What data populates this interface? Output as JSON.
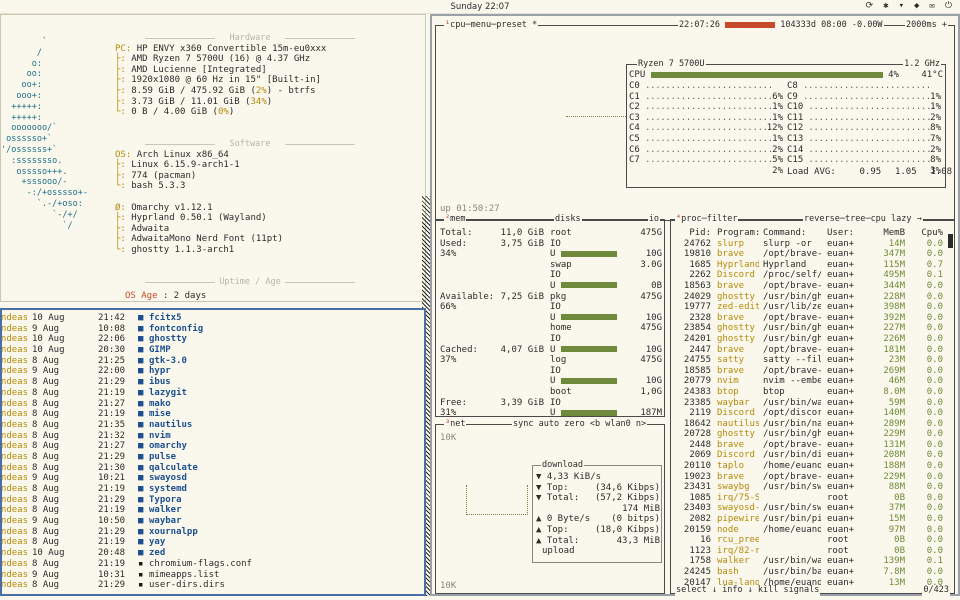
{
  "topbar": {
    "clock": "Sunday 22:07",
    "tray": [
      "⟳",
      "✱",
      "▾",
      "◆",
      "✉",
      "⏻"
    ]
  },
  "fastfetch": {
    "logo": "        `\n       /\n      o:\n     oo:\n    oo+:\n   ooo+:\n  +++++:\n  +++++:\n  ooooooo/`\n ossssso+`\n'/ossssss+`\n  :ssssssso.\n   osssso+++.\n    +sssooo/-\n     -:/+osssso+-\n       `.-/+oso:\n          `-/+/\n            `/",
    "hardware_title": "Hardware",
    "hardware": [
      {
        "k": "PC:",
        "v": "HP ENVY x360 Convertible 15m-eu0xxx"
      },
      {
        "k": "├:",
        "v": "AMD Ryzen 7 5700U (16) @ 4.37 GHz"
      },
      {
        "k": "├:",
        "v": "AMD Lucienne [Integrated]"
      },
      {
        "k": "├:",
        "v": "1920x1080 @ 60 Hz in 15\" [Built-in]"
      },
      {
        "k": "├:",
        "v": "8.59 GiB / 475.92 GiB (",
        "p": "2%",
        "s": ") - btrfs"
      },
      {
        "k": "├:",
        "v": "3.73 GiB / 11.01 GiB (",
        "p": "34%",
        "s": ")"
      },
      {
        "k": "└:",
        "v": "0 B / 4.00 GiB (",
        "p": "0%",
        "s": ")"
      }
    ],
    "software_title": "Software",
    "software": [
      {
        "k": "OS:",
        "v": "Arch Linux x86_64"
      },
      {
        "k": "├:",
        "v": "Linux 6.15.9-arch1-1"
      },
      {
        "k": "├:",
        "v": "774 (pacman)"
      },
      {
        "k": "└:",
        "v": "bash 5.3.3"
      },
      {
        "k": "",
        "v": ""
      },
      {
        "k": "Ø:",
        "v": "Omarchy v1.12.1"
      },
      {
        "k": "├:",
        "v": "Hyprland 0.50.1 (Wayland)"
      },
      {
        "k": "├:",
        "v": "Adwaita"
      },
      {
        "k": "├:",
        "v": "AdwaitaMono Nerd Font (11pt)"
      },
      {
        "k": "└:",
        "v": "ghostty 1.1.3-arch1"
      }
    ],
    "uptime_title": "Uptime / Age",
    "uptime_k": "OS Age",
    "uptime_v": ": 2 days"
  },
  "files": [
    {
      "u": "ndeas",
      "d": "10 Aug",
      "t": "21:42",
      "n": "fcitx5",
      "dir": true
    },
    {
      "u": "ndeas",
      "d": " 9 Aug",
      "t": "10:08",
      "n": "fontconfig",
      "dir": true
    },
    {
      "u": "ndeas",
      "d": "10 Aug",
      "t": "22:06",
      "n": "ghostty",
      "dir": true
    },
    {
      "u": "ndeas",
      "d": "10 Aug",
      "t": "20:30",
      "n": "GIMP",
      "dir": true
    },
    {
      "u": "ndeas",
      "d": " 8 Aug",
      "t": "21:25",
      "n": "gtk-3.0",
      "dir": true
    },
    {
      "u": "ndeas",
      "d": " 9 Aug",
      "t": "22:00",
      "n": "hypr",
      "dir": true
    },
    {
      "u": "ndeas",
      "d": " 8 Aug",
      "t": "21:29",
      "n": "ibus",
      "dir": true
    },
    {
      "u": "ndeas",
      "d": " 8 Aug",
      "t": "21:19",
      "n": "lazygit",
      "dir": true
    },
    {
      "u": "ndeas",
      "d": " 8 Aug",
      "t": "21:27",
      "n": "mako",
      "dir": true
    },
    {
      "u": "ndeas",
      "d": " 8 Aug",
      "t": "21:19",
      "n": "mise",
      "dir": true
    },
    {
      "u": "ndeas",
      "d": " 8 Aug",
      "t": "21:35",
      "n": "nautilus",
      "dir": true
    },
    {
      "u": "ndeas",
      "d": " 8 Aug",
      "t": "21:32",
      "n": "nvim",
      "dir": true
    },
    {
      "u": "ndeas",
      "d": " 8 Aug",
      "t": "21:27",
      "n": "omarchy",
      "dir": true
    },
    {
      "u": "ndeas",
      "d": " 8 Aug",
      "t": "21:29",
      "n": "pulse",
      "dir": true
    },
    {
      "u": "ndeas",
      "d": " 8 Aug",
      "t": "21:30",
      "n": "qalculate",
      "dir": true
    },
    {
      "u": "ndeas",
      "d": " 9 Aug",
      "t": "10:21",
      "n": "swayosd",
      "dir": true
    },
    {
      "u": "ndeas",
      "d": " 8 Aug",
      "t": "21:19",
      "n": "systemd",
      "dir": true
    },
    {
      "u": "ndeas",
      "d": " 8 Aug",
      "t": "21:29",
      "n": "Typora",
      "dir": true
    },
    {
      "u": "ndeas",
      "d": " 8 Aug",
      "t": "21:19",
      "n": "walker",
      "dir": true
    },
    {
      "u": "ndeas",
      "d": " 9 Aug",
      "t": "10:50",
      "n": "waybar",
      "dir": true
    },
    {
      "u": "ndeas",
      "d": " 8 Aug",
      "t": "21:29",
      "n": "xournalpp",
      "dir": true
    },
    {
      "u": "ndeas",
      "d": " 8 Aug",
      "t": "21:19",
      "n": "yay",
      "dir": true
    },
    {
      "u": "ndeas",
      "d": "10 Aug",
      "t": "20:48",
      "n": "zed",
      "dir": true
    },
    {
      "u": "ndeas",
      "d": " 8 Aug",
      "t": "21:19",
      "n": "chromium-flags.conf",
      "dir": false
    },
    {
      "u": "ndeas",
      "d": " 9 Aug",
      "t": "10:31",
      "n": "mimeapps.list",
      "dir": false
    },
    {
      "u": "ndeas",
      "d": " 8 Aug",
      "t": "21:29",
      "n": "user-dirs.dirs",
      "dir": false
    }
  ],
  "btop": {
    "cpu_title": "cpu",
    "menu": "menu",
    "preset": "preset *",
    "time": "22:07:26",
    "battery": "104333d 08:00 -0.00W",
    "refresh": "2000ms +",
    "cpu_name": "Ryzen 7 5700U",
    "cpu_freq": "1.2 GHz",
    "cpu_total_label": "CPU",
    "cpu_total_pct": "4%",
    "cpu_temp": "41°C",
    "cores_left": [
      [
        "C0",
        "6%"
      ],
      [
        "C1",
        "1%"
      ],
      [
        "C2",
        "1%"
      ],
      [
        "C3",
        "12%"
      ],
      [
        "C4",
        "1%"
      ],
      [
        "C5",
        "2%"
      ],
      [
        "C6",
        "5%"
      ],
      [
        "C7",
        "2%"
      ]
    ],
    "cores_right": [
      [
        "C8",
        "1%"
      ],
      [
        "C9",
        "1%"
      ],
      [
        "C10",
        "2%"
      ],
      [
        "C11",
        "8%"
      ],
      [
        "C12",
        "7%"
      ],
      [
        "C13",
        "2%"
      ],
      [
        "C14",
        "8%"
      ],
      [
        "C15",
        "3%"
      ]
    ],
    "load_label": "Load AVG:",
    "load": [
      "0.95",
      "1.05",
      "1.08"
    ],
    "uptime": "up 01:50:27",
    "mem_title": "mem",
    "disks_title": "disks",
    "io_label": "io",
    "mem": {
      "total_label": "Total:",
      "total": "11,0 GiB",
      "used_label": "Used:",
      "used": "3,75 GiB",
      "used_pct": "34%",
      "avail_label": "Available:",
      "avail": "7,25 GiB",
      "avail_pct": "66%",
      "cached_label": "Cached:",
      "cached": "4,07 GiB",
      "cached_pct": "37%",
      "free_label": "Free:",
      "free": "3,39 GiB",
      "free_pct": "31%"
    },
    "disks": [
      {
        "name": "root",
        "size": "475G",
        "io": "IO",
        "used": "10G"
      },
      {
        "name": "swap",
        "size": "3.0G",
        "io": "IO",
        "used": "0B"
      },
      {
        "name": "pkg",
        "size": "475G",
        "io": "IO",
        "used": "10G"
      },
      {
        "name": "home",
        "size": "475G",
        "io": "IO",
        "used": "10G"
      },
      {
        "name": "log",
        "size": "475G",
        "io": "IO",
        "used": "10G"
      },
      {
        "name": "boot",
        "size": "1,0G",
        "io": "IO",
        "used": "187M"
      }
    ],
    "net_title": "net",
    "net_sync": "sync",
    "net_auto": "auto",
    "net_zero": "zero",
    "net_b": "<b",
    "net_iface": "wlan0",
    "net_n": "n>",
    "net_scale_top": "10K",
    "net_scale_bot": "10K",
    "download_label": "download",
    "dl_rate": "4,33 KiB/s",
    "dl_bits": "(34,6 Kibps)",
    "dl_top_label": "Top:",
    "dl_top": "(57,2 Kibps)",
    "dl_total_label": "Total:",
    "dl_total": "174 MiB",
    "ul_rate": "0 Byte/s",
    "ul_bits": "(0 bitps)",
    "ul_top_label": "Top:",
    "ul_top": "(18,0 Kibps)",
    "ul_total_label": "Total:",
    "ul_total": "43,3 MiB",
    "upload_label": "upload",
    "proc_title": "proc",
    "filter": "filter",
    "reverse": "reverse",
    "tree": "tree",
    "sort": "cpu lazy",
    "col_pid": "Pid:",
    "col_prog": "Program:",
    "col_cmd": "Command:",
    "col_user": "User:",
    "col_mem": "MemB",
    "col_cpu": "Cpu%",
    "procs": [
      [
        "24762",
        "slurp",
        "slurp -or",
        "euan+",
        "14M",
        "0.0"
      ],
      [
        "19810",
        "brave",
        "/opt/brave-b",
        "euan+",
        "347M",
        "0.0"
      ],
      [
        "1685",
        "Hyprland",
        "Hyprland",
        "euan+",
        "115M",
        "0.7"
      ],
      [
        "2262",
        "Discord",
        "/proc/self/e",
        "euan+",
        "495M",
        "0.1"
      ],
      [
        "18563",
        "brave",
        "/opt/brave-b",
        "euan+",
        "344M",
        "0.0"
      ],
      [
        "24029",
        "ghostty",
        "/usr/bin/gho",
        "euan+",
        "228M",
        "0.0"
      ],
      [
        "19777",
        "zed-edit",
        "/usr/lib/zed",
        "euan+",
        "398M",
        "0.0"
      ],
      [
        "2328",
        "brave",
        "/opt/brave-b",
        "euan+",
        "392M",
        "0.0"
      ],
      [
        "23854",
        "ghostty",
        "/usr/bin/gho",
        "euan+",
        "227M",
        "0.0"
      ],
      [
        "24201",
        "ghostty",
        "/usr/bin/gho",
        "euan+",
        "226M",
        "0.0"
      ],
      [
        "2447",
        "brave",
        "/opt/brave-b",
        "euan+",
        "181M",
        "0.0"
      ],
      [
        "24755",
        "satty",
        "satty --file",
        "euan+",
        "23M",
        "0.0"
      ],
      [
        "18585",
        "brave",
        "/opt/brave-b",
        "euan+",
        "269M",
        "0.0"
      ],
      [
        "20779",
        "nvim",
        "nvim --embed",
        "euan+",
        "46M",
        "0.0"
      ],
      [
        "24383",
        "btop",
        "btop",
        "euan+",
        "8.0M",
        "0.0"
      ],
      [
        "23385",
        "waybar",
        "/usr/bin/way",
        "euan+",
        "59M",
        "0.0"
      ],
      [
        "2119",
        "Discord",
        "/opt/discord",
        "euan+",
        "140M",
        "0.0"
      ],
      [
        "18642",
        "nautilus",
        "/usr/bin/nau",
        "euan+",
        "289M",
        "0.0"
      ],
      [
        "20728",
        "ghostty",
        "/usr/bin/gho",
        "euan+",
        "229M",
        "0.0"
      ],
      [
        "2448",
        "brave",
        "/opt/brave-b",
        "euan+",
        "131M",
        "0.0"
      ],
      [
        "2069",
        "Discord",
        "/usr/bin/dis",
        "euan+",
        "208M",
        "0.0"
      ],
      [
        "20110",
        "taplo",
        "/home/euande",
        "euan+",
        "188M",
        "0.0"
      ],
      [
        "19023",
        "brave",
        "/opt/brave-b",
        "euan+",
        "229M",
        "0.0"
      ],
      [
        "23431",
        "swaybg",
        "/usr/bin/swa",
        "euan+",
        "88M",
        "0.0"
      ],
      [
        "1085",
        "irq/75-S",
        "",
        "root",
        "0B",
        "0.0"
      ],
      [
        "23403",
        "swayosd-",
        "/usr/bin/swa",
        "euan+",
        "37M",
        "0.0"
      ],
      [
        "2082",
        "pipewire",
        "/usr/bin/pip",
        "euan+",
        "15M",
        "0.0"
      ],
      [
        "20159",
        "node",
        "/home/euande",
        "euan+",
        "97M",
        "0.0"
      ],
      [
        "16",
        "rcu_pree",
        "",
        "root",
        "0B",
        "0.0"
      ],
      [
        "1123",
        "irq/82-r",
        "",
        "root",
        "0B",
        "0.0"
      ],
      [
        "1758",
        "walker",
        "/usr/bin/wal",
        "euan+",
        "139M",
        "0.1"
      ],
      [
        "24245",
        "bash",
        "/usr/bin/bas",
        "euan+",
        "7.8M",
        "0.0"
      ],
      [
        "20147",
        "lua-lang",
        "/home/euande",
        "euan+",
        "13M",
        "0.0"
      ]
    ],
    "proc_select": "select",
    "proc_info": "info",
    "proc_kill": "kill",
    "proc_signals": "signals",
    "proc_count": "0/423"
  }
}
